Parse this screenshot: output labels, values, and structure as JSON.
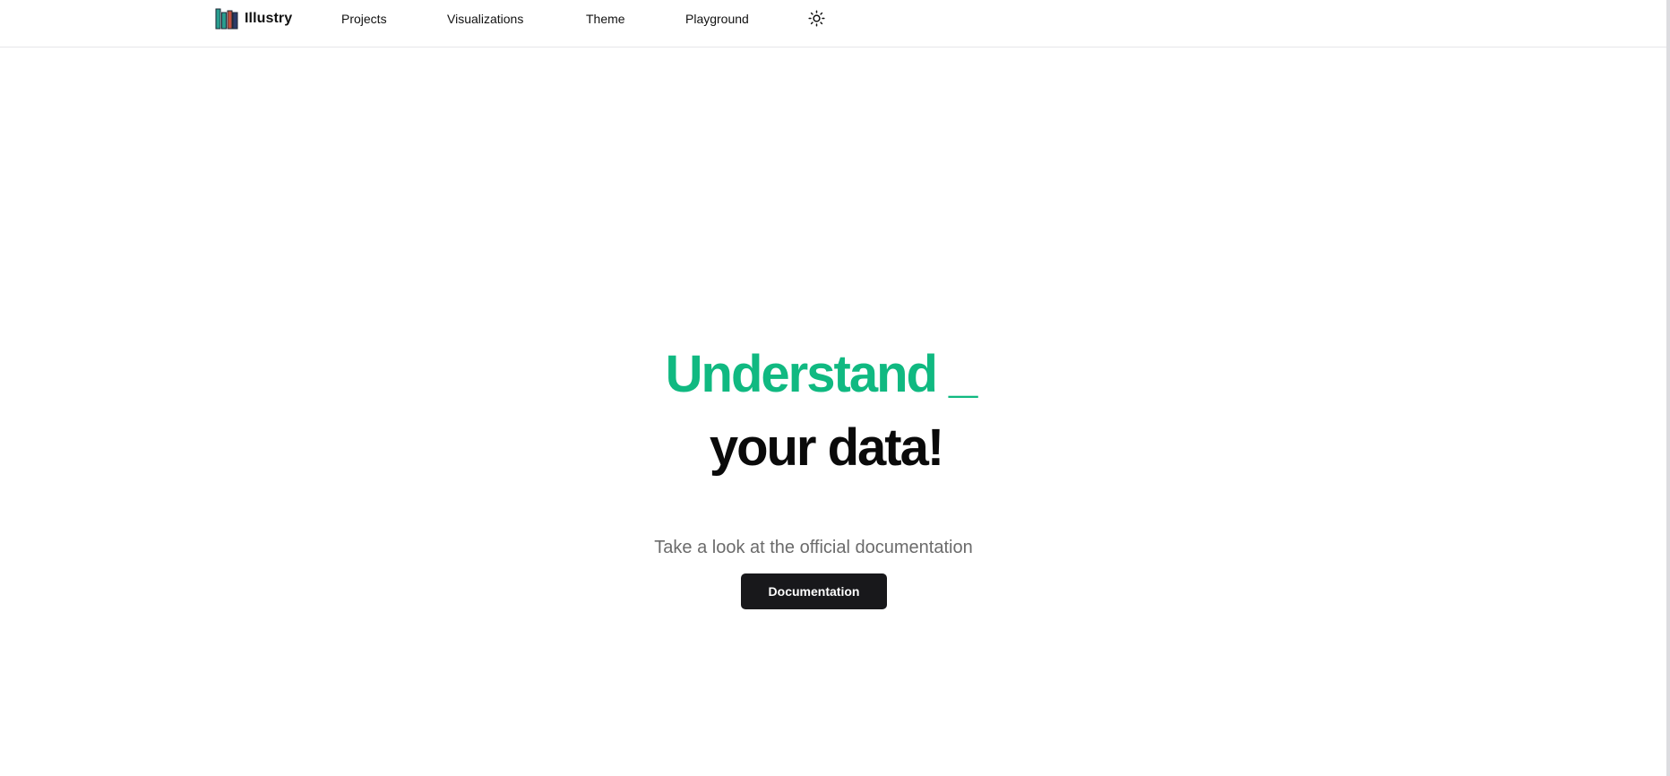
{
  "header": {
    "brand": "Illustry",
    "brand_icon": "bookshelf-logo-icon",
    "nav": {
      "projects": "Projects",
      "visualizations": "Visualizations",
      "theme": "Theme",
      "playground": "Playground"
    },
    "theme_toggle_icon": "sun-icon"
  },
  "hero": {
    "headline_accent": "Understand _",
    "headline_main": "your data!",
    "subtitle": "Take a look at the official documentation",
    "button_label": "Documentation"
  },
  "colors": {
    "accent": "#10b981",
    "headline": "#0a0a0a",
    "button_bg": "#18181b",
    "subtitle": "#6b6b6b",
    "logo_teal": "#2a9d8f",
    "logo_red": "#c0503e",
    "logo_navy": "#2b3a67"
  }
}
